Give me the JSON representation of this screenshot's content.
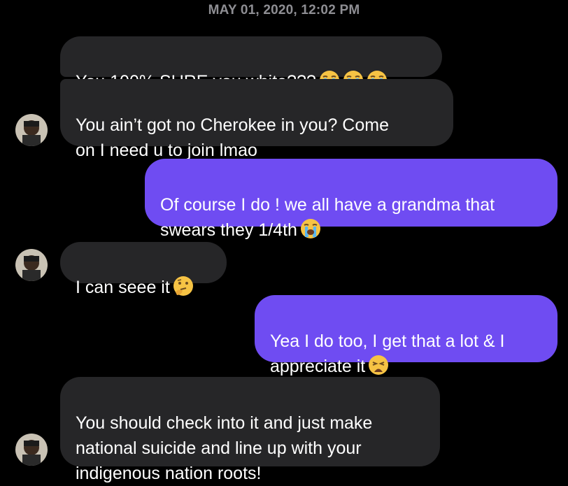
{
  "header": {
    "timestamp": "MAY 01, 2020, 12:02 PM"
  },
  "colors": {
    "background": "#000000",
    "incoming_bubble": "#262628",
    "outgoing_bubble": "#6f4cf2",
    "timestamp_text": "#8e8e93"
  },
  "messages": [
    {
      "direction": "incoming",
      "text": "You 100% SURE you white???",
      "emoji": [
        "loudly-crying-face-icon",
        "loudly-crying-face-icon",
        "loudly-crying-face-icon"
      ]
    },
    {
      "direction": "incoming",
      "text": "You ain’t got no Cherokee in you? Come\non I need u to join lmao",
      "emoji": []
    },
    {
      "direction": "outgoing",
      "text": "Of course I do ! we all have a grandma that\nswears they 1/4th",
      "emoji": [
        "loudly-crying-face-icon"
      ]
    },
    {
      "direction": "incoming",
      "text": "I can seee it",
      "emoji": [
        "thinking-face-icon"
      ]
    },
    {
      "direction": "outgoing",
      "text": "Yea I do too, I get that a lot & I\nappreciate it",
      "emoji": [
        "weary-face-icon"
      ]
    },
    {
      "direction": "incoming",
      "text": "You should check into it and just make\nnational suicide and line up with your\nindigenous nation roots!",
      "emoji": []
    }
  ]
}
